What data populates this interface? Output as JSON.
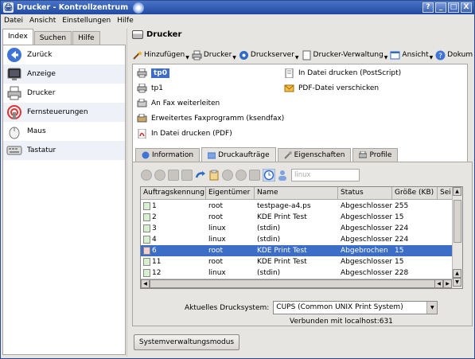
{
  "window": {
    "title": "Drucker - Kontrollzentrum",
    "btn_help": "?",
    "btn_min": "_",
    "btn_max": "□",
    "btn_close": "X"
  },
  "menubar": {
    "items": [
      "Datei",
      "Ansicht",
      "Einstellungen",
      "Hilfe"
    ]
  },
  "left_tabs": [
    "Index",
    "Suchen",
    "Hilfe"
  ],
  "left_items": [
    {
      "label": "Zurück",
      "icon": "back-arrow-icon"
    },
    {
      "label": "Anzeige",
      "icon": "display-icon"
    },
    {
      "label": "Drucker",
      "icon": "printer-icon"
    },
    {
      "label": "Fernsteuerungen",
      "icon": "remote-icon"
    },
    {
      "label": "Maus",
      "icon": "mouse-icon"
    },
    {
      "label": "Tastatur",
      "icon": "keyboard-icon"
    }
  ],
  "header": {
    "title": "Drucker"
  },
  "toolbar": {
    "add": "Hinzufügen",
    "printer": "Drucker",
    "server": "Druckserver",
    "manage": "Drucker-Verwaltung",
    "view": "Ansicht",
    "docs": "Dokum",
    "more": "»"
  },
  "printers": {
    "col1": [
      "tp0",
      "tp1",
      "An Fax weiterleiten",
      "Erweitertes Faxprogramm (ksendfax)",
      "In Datei drucken (PDF)"
    ],
    "col2": [
      "In Datei drucken (PostScript)",
      "PDF-Datei verschicken"
    ]
  },
  "tabs": [
    "Information",
    "Druckaufträge",
    "Eigenschaften",
    "Profile"
  ],
  "jobs": {
    "search_placeholder": "linux",
    "headers": [
      "Auftragskennung",
      "Eigentümer",
      "Name",
      "Status",
      "Größe (KB)",
      "Sei"
    ],
    "rows": [
      [
        "1",
        "root",
        "testpage-a4.ps",
        "Abgeschlossen",
        "255"
      ],
      [
        "2",
        "root",
        "KDE Print Test",
        "Abgeschlossen",
        "15"
      ],
      [
        "3",
        "linux",
        "(stdin)",
        "Abgeschlossen",
        "224"
      ],
      [
        "4",
        "linux",
        "(stdin)",
        "Abgeschlossen",
        "224"
      ],
      [
        "6",
        "root",
        "KDE Print Test",
        "Abgebrochen",
        "15"
      ],
      [
        "11",
        "root",
        "KDE Print Test",
        "Abgeschlossen",
        "15"
      ],
      [
        "12",
        "linux",
        "(stdin)",
        "Abgeschlossen",
        "228"
      ]
    ],
    "selected_index": 4
  },
  "footer": {
    "system_label": "Aktuelles Drucksystem:",
    "system_value": "CUPS (Common UNIX Print System)",
    "connected": "Verbunden mit localhost:631",
    "admin_button": "Systemverwaltungsmodus"
  },
  "colors": {
    "selection": "#3c6ec8",
    "titlebar": "#2a57b2"
  }
}
